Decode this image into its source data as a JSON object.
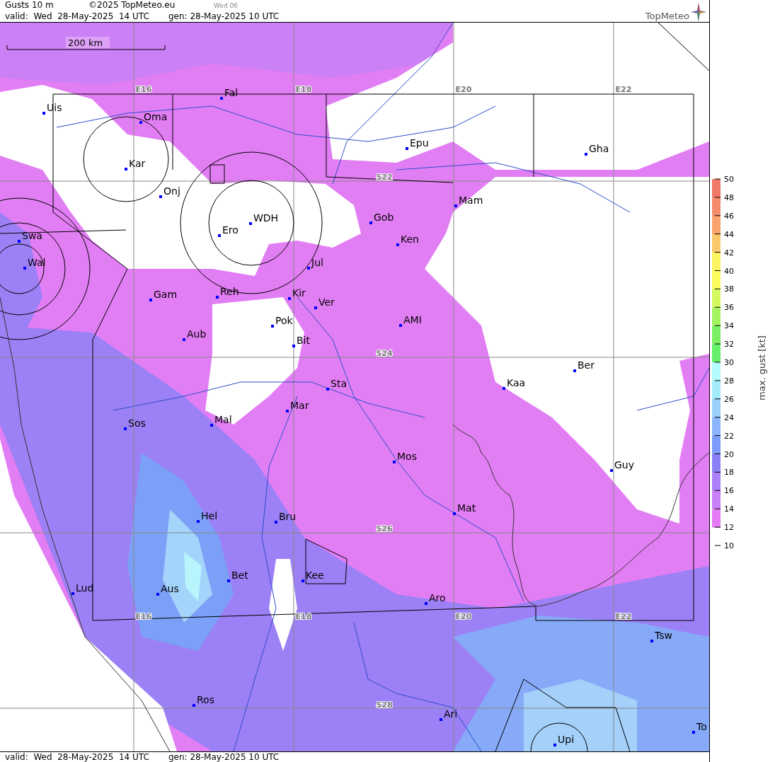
{
  "header": {
    "title": "Gusts 10 m",
    "copyright": "©2025 TopMeteo.eu",
    "day_code": "Wed 06",
    "valid": "valid:  Wed  28-May-2025  14 UTC",
    "generated": "gen: 28-May-2025 10 UTC",
    "logo": "TopMeteo"
  },
  "map": {
    "scale": "200 km",
    "grid_labels": [
      {
        "text": "E16"
      },
      {
        "text": "E18"
      },
      {
        "text": "E20"
      },
      {
        "text": "E22"
      },
      {
        "text": "S22"
      },
      {
        "text": "S24"
      },
      {
        "text": "S26"
      },
      {
        "text": "S28"
      },
      {
        "text": "E16"
      },
      {
        "text": "E18"
      },
      {
        "text": "E20"
      },
      {
        "text": "E22"
      }
    ],
    "places": [
      {
        "name": "Uis"
      },
      {
        "name": "Fal"
      },
      {
        "name": "Oma"
      },
      {
        "name": "Epu"
      },
      {
        "name": "Gha"
      },
      {
        "name": "Kar"
      },
      {
        "name": "Onj"
      },
      {
        "name": "Mam"
      },
      {
        "name": "Gob"
      },
      {
        "name": "WDH"
      },
      {
        "name": "Swa"
      },
      {
        "name": "Ero"
      },
      {
        "name": "Ken"
      },
      {
        "name": "Wal"
      },
      {
        "name": "Jul"
      },
      {
        "name": "Gam"
      },
      {
        "name": "Reh"
      },
      {
        "name": "Kir"
      },
      {
        "name": "Ver"
      },
      {
        "name": "AMI"
      },
      {
        "name": "Pok"
      },
      {
        "name": "Aub"
      },
      {
        "name": "Bit"
      },
      {
        "name": "Ber"
      },
      {
        "name": "Sta"
      },
      {
        "name": "Kaa"
      },
      {
        "name": "Mar"
      },
      {
        "name": "Sos"
      },
      {
        "name": "Mal"
      },
      {
        "name": "Mos"
      },
      {
        "name": "Guy"
      },
      {
        "name": "Mat"
      },
      {
        "name": "Hel"
      },
      {
        "name": "Bru"
      },
      {
        "name": "Bet"
      },
      {
        "name": "Kee"
      },
      {
        "name": "Lud"
      },
      {
        "name": "Aus"
      },
      {
        "name": "Aro"
      },
      {
        "name": "Tsw"
      },
      {
        "name": "Ros"
      },
      {
        "name": "Ari"
      },
      {
        "name": "To"
      },
      {
        "name": "Upi"
      }
    ]
  },
  "legend": {
    "title": "max. gust [kt]",
    "ticks": [
      "50",
      "48",
      "46",
      "44",
      "42",
      "40",
      "38",
      "36",
      "34",
      "32",
      "30",
      "28",
      "26",
      "24",
      "22",
      "20",
      "18",
      "16",
      "14",
      "12",
      "10"
    ],
    "bands": [
      {
        "color": "#ef7a68"
      },
      {
        "color": "#f48c6c"
      },
      {
        "color": "#f8a46c"
      },
      {
        "color": "#fcc86c"
      },
      {
        "color": "#fcf460"
      },
      {
        "color": "#fcfc5c"
      },
      {
        "color": "#d4f860"
      },
      {
        "color": "#a4f460"
      },
      {
        "color": "#7cf064"
      },
      {
        "color": "#64f068"
      },
      {
        "color": "#b4fcfc"
      },
      {
        "color": "#a4ecfc"
      },
      {
        "color": "#9cd0fc"
      },
      {
        "color": "#8cb4fc"
      },
      {
        "color": "#7c9cfc"
      },
      {
        "color": "#8c80f8"
      },
      {
        "color": "#ac80f8"
      },
      {
        "color": "#c880f8"
      },
      {
        "color": "#e47cf4"
      }
    ]
  },
  "footer": {
    "valid": "valid:  Wed  28-May-2025  14 UTC",
    "generated": "gen: 28-May-2025 10 UTC"
  }
}
